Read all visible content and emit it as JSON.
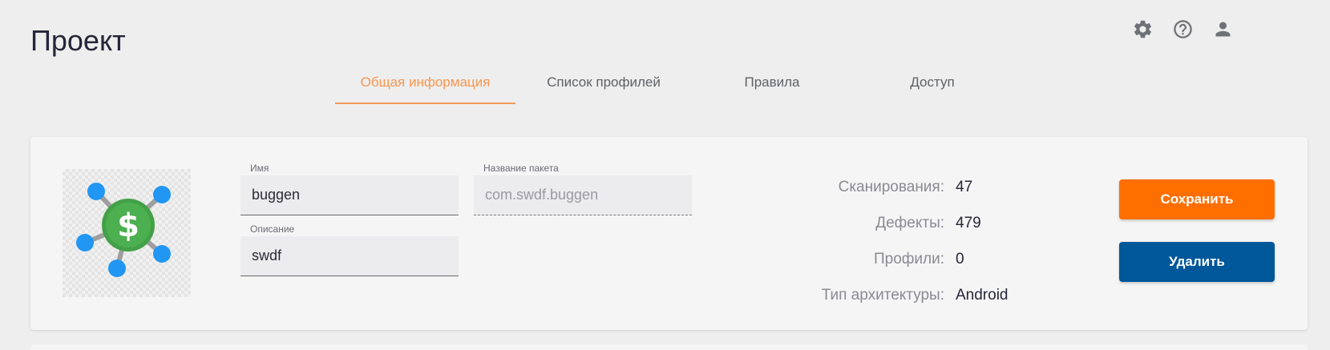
{
  "header": {
    "title": "Проект",
    "icons": [
      "gear-icon",
      "help-icon",
      "user-icon"
    ]
  },
  "tabs": [
    {
      "label": "Общая информация",
      "active": true
    },
    {
      "label": "Список профилей",
      "active": false
    },
    {
      "label": "Правила",
      "active": false
    },
    {
      "label": "Доступ",
      "active": false
    }
  ],
  "form": {
    "name_label": "Имя",
    "name_value": "buggen",
    "package_label": "Название пакета",
    "package_value": "com.swdf.buggen",
    "description_label": "Описание",
    "description_value": "swdf"
  },
  "stats": [
    {
      "label": "Сканирования:",
      "value": "47"
    },
    {
      "label": "Дефекты:",
      "value": "479"
    },
    {
      "label": "Профили:",
      "value": "0"
    },
    {
      "label": "Тип архитектуры:",
      "value": "Android"
    }
  ],
  "actions": {
    "save_label": "Сохранить",
    "delete_label": "Удалить"
  },
  "colors": {
    "accent": "#f79750",
    "save": "#ff6f00",
    "delete": "#00579a",
    "logo_node": "#2196f3",
    "logo_center": "#4caf50"
  }
}
